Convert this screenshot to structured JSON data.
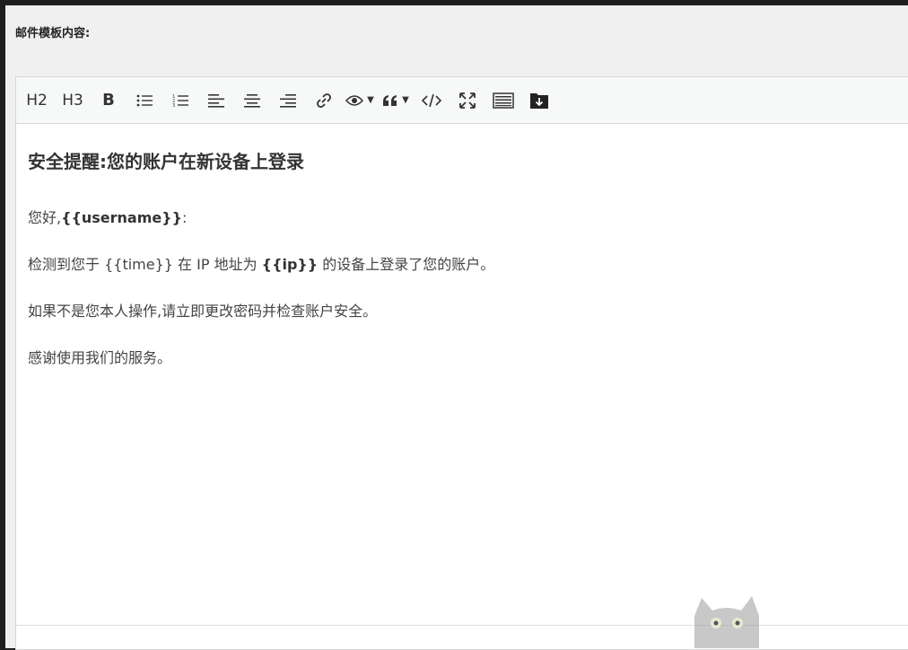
{
  "field_label": "邮件模板内容:",
  "toolbar": {
    "h2": "H2",
    "h3": "H3",
    "bold": "B"
  },
  "content": {
    "heading": "安全提醒:您的账户在新设备上登录",
    "greeting_prefix": "您好,",
    "greeting_var": "{{username}}",
    "greeting_suffix": ":",
    "line1_a": "检测到您于 {{time}} 在 IP 地址为 ",
    "line1_var": "{{ip}}",
    "line1_b": " 的设备上登录了您的账户。",
    "line2": "如果不是您本人操作,请立即更改密码并检查账户安全。",
    "line3": "感谢使用我们的服务。"
  },
  "icons": [
    "heading-2-icon",
    "heading-3-icon",
    "bold-icon",
    "unordered-list-icon",
    "ordered-list-icon",
    "align-left-icon",
    "align-center-icon",
    "align-right-icon",
    "link-icon",
    "preview-icon",
    "quote-icon",
    "code-icon",
    "fullscreen-icon",
    "keyboard-icon",
    "download-icon"
  ]
}
